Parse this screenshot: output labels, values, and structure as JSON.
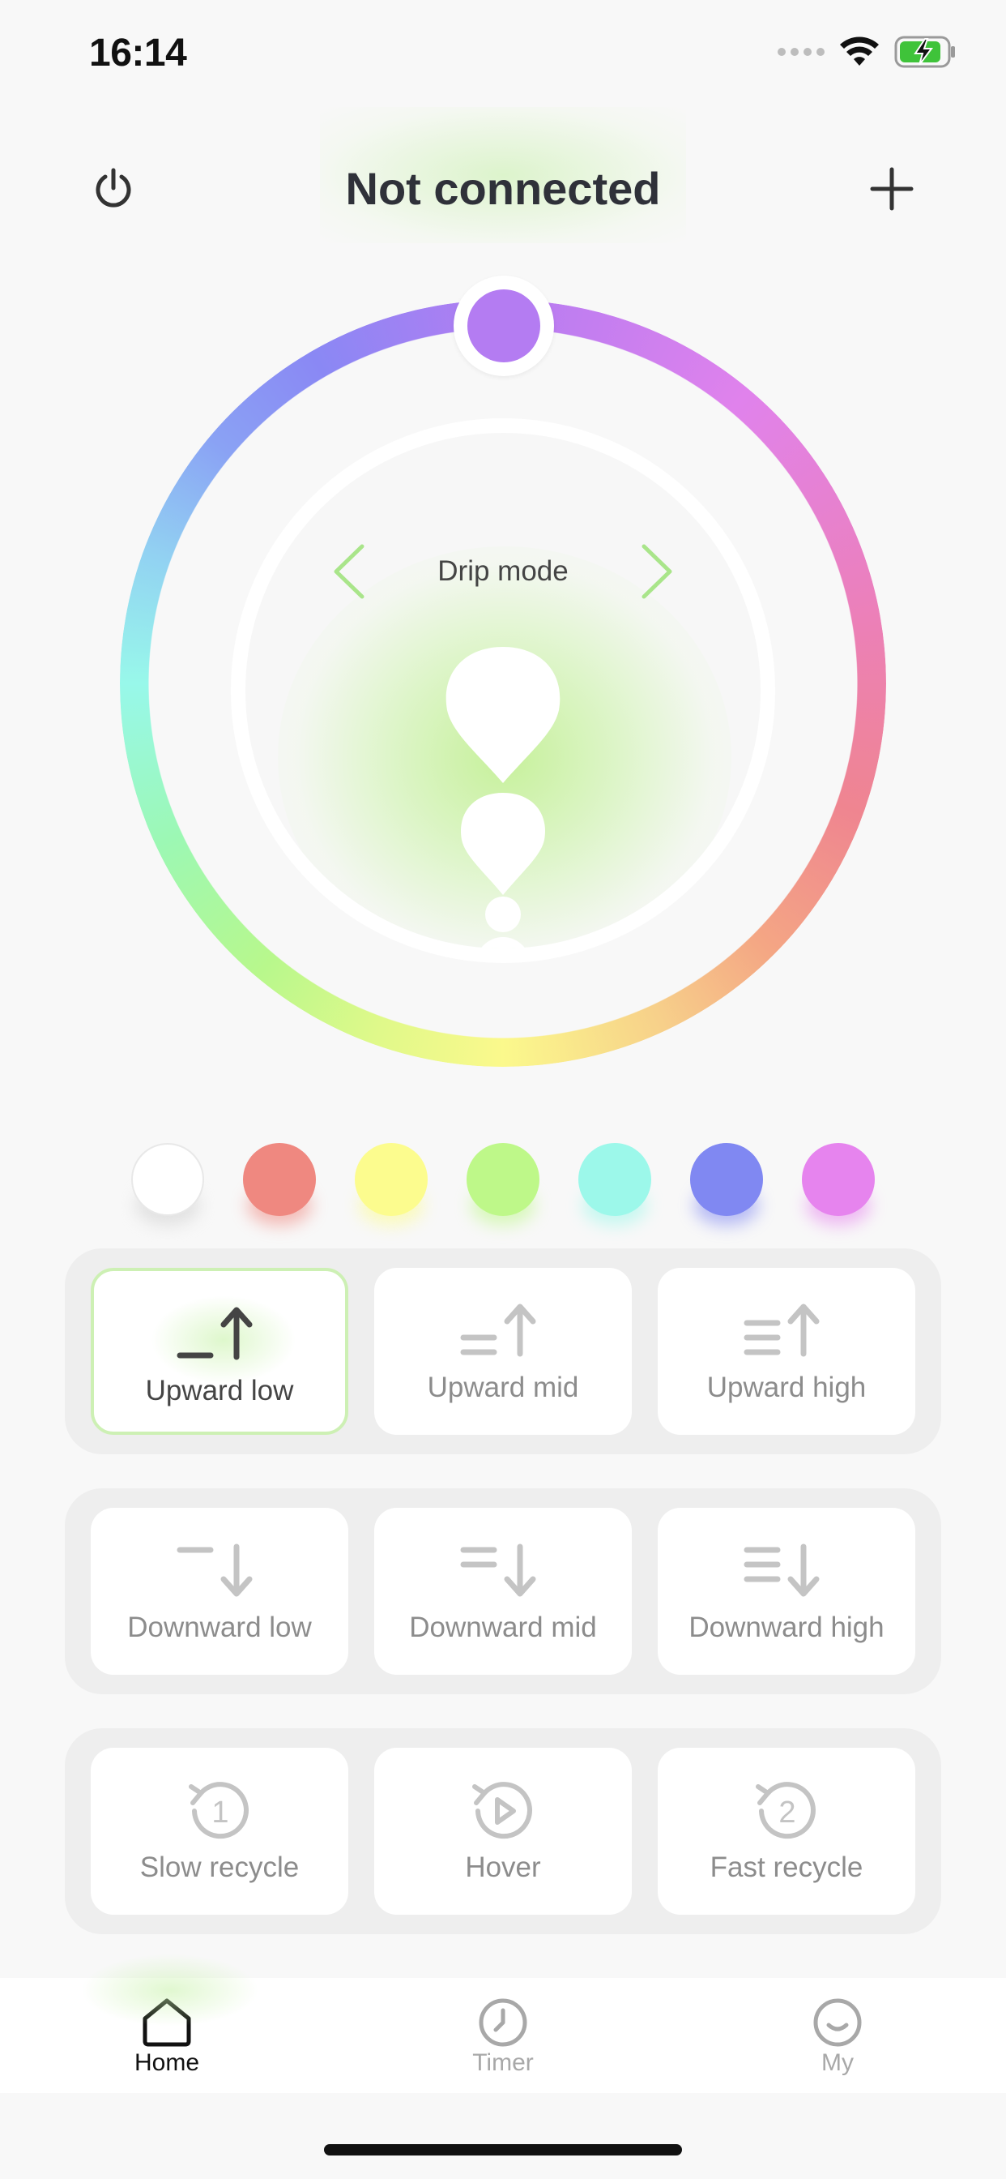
{
  "status_bar": {
    "time": "16:14",
    "icons": [
      "signal-dots-icon",
      "wifi-icon",
      "battery-charging-icon"
    ],
    "battery_color": "#3fc33a"
  },
  "header": {
    "title": "Not connected",
    "left_icon": "power-icon",
    "right_icon": "plus-icon"
  },
  "color_wheel": {
    "selected_color": "#b47cf2",
    "mode_label": "Drip mode",
    "prev_icon": "chevron-left-icon",
    "next_icon": "chevron-right-icon",
    "accent": "#a9e58a"
  },
  "swatches": [
    {
      "name": "white",
      "color": "#ffffff"
    },
    {
      "name": "red",
      "color": "#ef8880"
    },
    {
      "name": "yellow",
      "color": "#fcfc8e"
    },
    {
      "name": "green",
      "color": "#bef889"
    },
    {
      "name": "cyan",
      "color": "#9cf8ea"
    },
    {
      "name": "blue",
      "color": "#8088f2"
    },
    {
      "name": "magenta",
      "color": "#e684ee"
    }
  ],
  "modes": {
    "upward": [
      {
        "label": "Upward low",
        "icon": "upward-low-icon",
        "active": true
      },
      {
        "label": "Upward mid",
        "icon": "upward-mid-icon",
        "active": false
      },
      {
        "label": "Upward high",
        "icon": "upward-high-icon",
        "active": false
      }
    ],
    "downward": [
      {
        "label": "Downward low",
        "icon": "downward-low-icon",
        "active": false
      },
      {
        "label": "Downward mid",
        "icon": "downward-mid-icon",
        "active": false
      },
      {
        "label": "Downward high",
        "icon": "downward-high-icon",
        "active": false
      }
    ],
    "recycle": [
      {
        "label": "Slow recycle",
        "icon": "recycle-one-icon",
        "active": false
      },
      {
        "label": "Hover",
        "icon": "hover-play-icon",
        "active": false
      },
      {
        "label": "Fast recycle",
        "icon": "recycle-two-icon",
        "active": false
      }
    ]
  },
  "tabbar": {
    "tabs": [
      {
        "label": "Home",
        "icon": "home-icon",
        "active": true
      },
      {
        "label": "Timer",
        "icon": "clock-icon",
        "active": false
      },
      {
        "label": "My",
        "icon": "smile-icon",
        "active": false
      }
    ],
    "active_color": "#111111",
    "inactive_color": "#a8a8a8"
  }
}
